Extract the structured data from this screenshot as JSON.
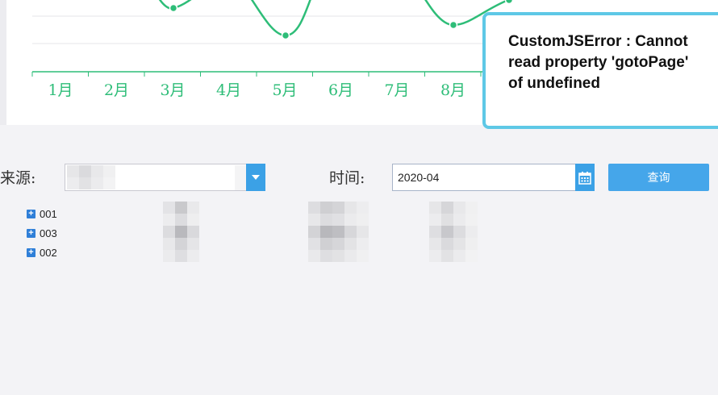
{
  "chart_data": {
    "type": "line",
    "categories": [
      "1月",
      "2月",
      "3月",
      "4月",
      "5月",
      "6月",
      "7月",
      "8月"
    ],
    "series_color": "#2ebd78",
    "grid": true
  },
  "error_popup": {
    "message": "CustomJSError : Cannot read property 'gotoPage' of undefined",
    "border_color": "#5ec8e6"
  },
  "filters": {
    "source_label": "来源:",
    "source_value": "",
    "time_label": "时间:",
    "time_value": "2020-04",
    "query_label": "查询"
  },
  "tree": {
    "items": [
      {
        "toggle": "+",
        "label": "001"
      },
      {
        "toggle": "+",
        "label": "003"
      },
      {
        "toggle": "+",
        "label": "002"
      }
    ]
  },
  "colors": {
    "accent": "#3ba1e6",
    "line": "#2ebd78"
  }
}
